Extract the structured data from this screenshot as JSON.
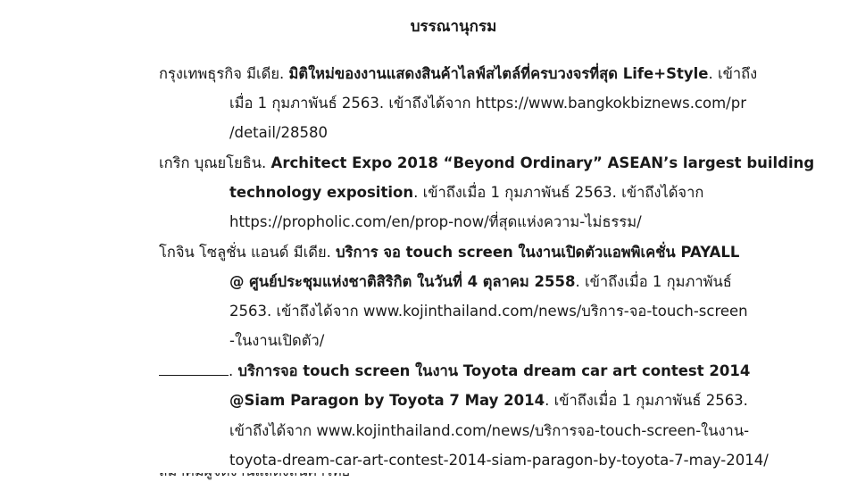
{
  "heading": "บรรณานุกรม",
  "entries": [
    {
      "lines": [
        {
          "a": "กรุงเทพธุรกิจ มีเดีย.  ",
          "b": "มิติใหม่ของงานแสดงสินค้าไลฟ์สไตล์ที่ครบวงจรที่สุด Life+Style",
          "c": ".  เข้าถึง"
        },
        {
          "a": "เมื่อ 1 กุมภาพันธ์ 2563.  เข้าถึงได้จาก https://www.bangkokbiznews.com/pr",
          "b": "",
          "c": ""
        },
        {
          "a": "/detail/28580",
          "b": "",
          "c": ""
        }
      ]
    },
    {
      "lines": [
        {
          "a": "เกริก บุณยโยธิน.  ",
          "b": "Architect Expo 2018 “Beyond Ordinary” ASEAN’s largest building",
          "c": ""
        },
        {
          "a": "",
          "b": "technology exposition",
          "c": ".  เข้าถึงเมื่อ 1 กุมภาพันธ์ 2563.  เข้าถึงได้จาก"
        },
        {
          "a": "https://propholic.com/en/prop-now/ที่สุดแห่งความ-ไม่ธรรม/",
          "b": "",
          "c": ""
        }
      ]
    },
    {
      "lines": [
        {
          "a": "โกจิน โซลูชั่น แอนด์ มีเดีย.  ",
          "b": "บริการ จอ touch screen ในงานเปิดตัวแอพพิเคชั่น PAYALL",
          "c": ""
        },
        {
          "a": "",
          "b": "@ ศูนย์ประชุมแห่งชาติสิริกิต ในวันที่ 4 ตุลาคม 2558",
          "c": ".  เข้าถึงเมื่อ 1 กุมภาพันธ์"
        },
        {
          "a": "2563.  เข้าถึงได้จาก www.kojinthailand.com/news/บริการ-จอ-touch-screen",
          "b": "",
          "c": ""
        },
        {
          "a": "-ในงานเปิดตัว/",
          "b": "",
          "c": ""
        }
      ]
    },
    {
      "lines": [
        {
          "a": ".  ",
          "b": "บริการจอ touch screen ในงาน Toyota dream car art contest 2014",
          "c": ""
        },
        {
          "a": "",
          "b": "@Siam Paragon by Toyota 7 May 2014",
          "c": ".  เข้าถึงเมื่อ 1 กุมภาพันธ์ 2563."
        },
        {
          "a": "เข้าถึงได้จาก www.kojinthailand.com/news/บริการจอ-touch-screen-ในงาน-",
          "b": "",
          "c": ""
        },
        {
          "a": "toyota-dream-car-art-contest-2014-siam-paragon-by-toyota-7-may-2014/",
          "b": "",
          "c": ""
        }
      ]
    }
  ],
  "partial_next_line": "สมาคมผู้จัดงานแสดงสินค้าไทย"
}
